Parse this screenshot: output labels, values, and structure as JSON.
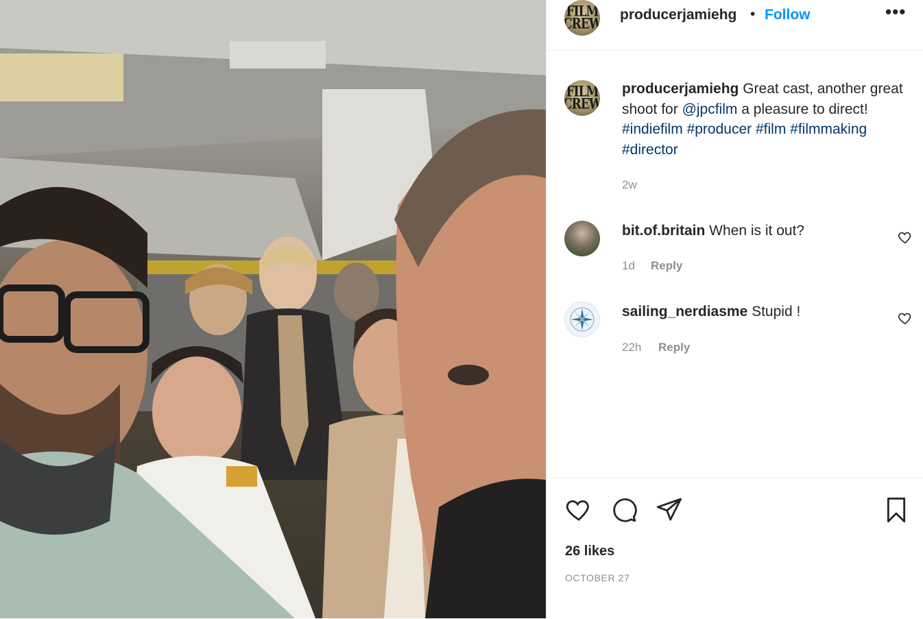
{
  "post": {
    "author_avatar_text": [
      "FILM",
      "CREW"
    ],
    "author": "producerjamiehg",
    "dot": "•",
    "follow_label": "Follow",
    "more_label": "•••",
    "caption": {
      "author": "producerjamiehg",
      "text_1": " Great cast, another great shoot for ",
      "mention": "@jpcfilm",
      "text_2": " a pleasure to direct! ",
      "hashtags": [
        "#indiefilm",
        "#producer",
        "#film",
        "#filmmaking",
        "#director"
      ],
      "time": "2w"
    },
    "photo_icon": "group-selfie-photo"
  },
  "comments": [
    {
      "user": "bit.of.britain",
      "text": " When is it out?",
      "time": "1d",
      "reply_label": "Reply",
      "avatar_icon": "user-avatar"
    },
    {
      "user": "sailing_nerdiasme",
      "text": " Stupid !",
      "time": "22h",
      "reply_label": "Reply",
      "avatar_icon": "compass-rose-avatar"
    }
  ],
  "footer": {
    "likes": "26 likes",
    "date": "OCTOBER 27"
  },
  "colors": {
    "accent": "#0095f6",
    "link": "#00376b",
    "muted": "#8e8e8e",
    "text": "#262626"
  }
}
